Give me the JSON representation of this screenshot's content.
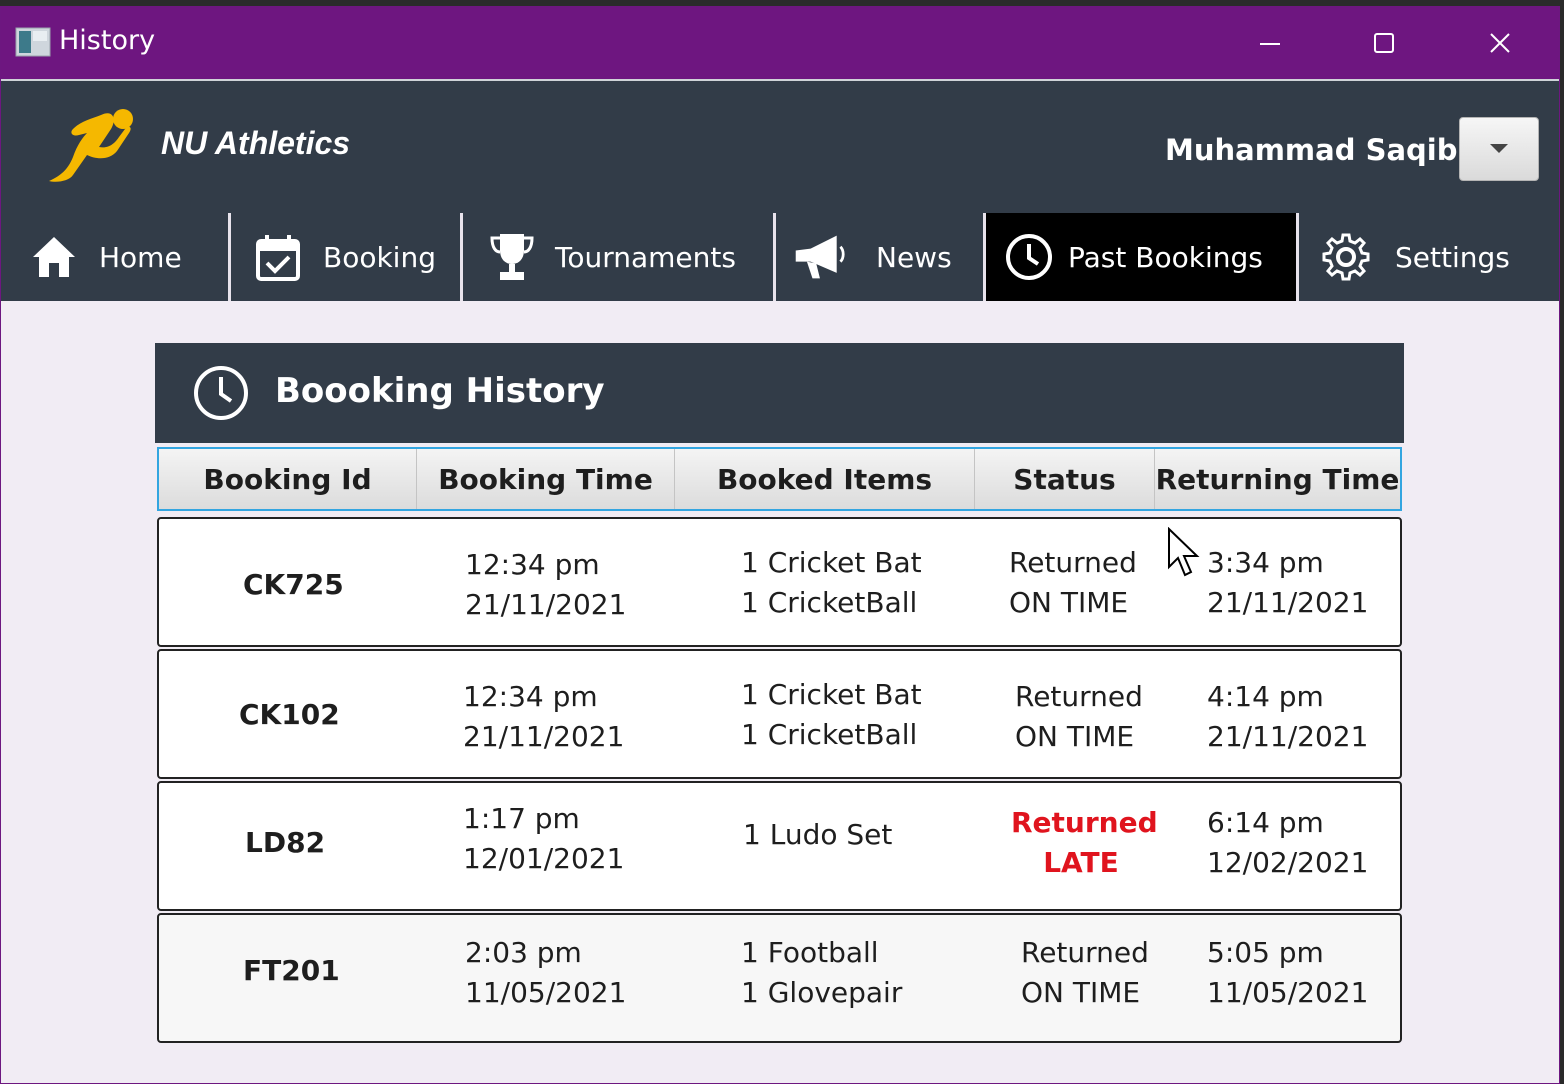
{
  "window": {
    "title": "History"
  },
  "header": {
    "brand": "NU Athletics",
    "username": "Muhammad Saqib"
  },
  "nav": {
    "tabs": [
      {
        "label": "Home",
        "icon": "home-icon"
      },
      {
        "label": "Booking",
        "icon": "calendar-check-icon"
      },
      {
        "label": "Tournaments",
        "icon": "trophy-icon"
      },
      {
        "label": "News",
        "icon": "megaphone-icon"
      },
      {
        "label": "Past Bookings",
        "icon": "clock-icon",
        "active": true
      },
      {
        "label": "Settings",
        "icon": "gear-icon"
      }
    ]
  },
  "history": {
    "title": "Boooking History",
    "columns": [
      "Booking Id",
      "Booking Time",
      "Booked Items",
      "Status",
      "Returning Time"
    ],
    "rows": [
      {
        "id": "CK725",
        "time": "12:34 pm",
        "date": "21/11/2021",
        "item1": "1 Cricket Bat",
        "item2": "1 CricketBall",
        "status1": "Returned",
        "status2": "ON TIME",
        "ret_time": "3:34 pm",
        "ret_date": "21/11/2021"
      },
      {
        "id": "CK102",
        "time": "12:34 pm",
        "date": "21/11/2021",
        "item1": "1 Cricket Bat",
        "item2": "1 CricketBall",
        "status1": "Returned",
        "status2": "ON TIME",
        "ret_time": "4:14 pm",
        "ret_date": "21/11/2021"
      },
      {
        "id": "LD82",
        "time": "1:17 pm",
        "date": "12/01/2021",
        "item1": "1 Ludo Set",
        "item2": "",
        "status1": "Returned",
        "status2": "LATE",
        "ret_time": "6:14 pm",
        "ret_date": "12/02/2021",
        "late": true
      },
      {
        "id": "FT201",
        "time": "2:03 pm",
        "date": "11/05/2021",
        "item1": "1 Football",
        "item2": "1 Glovepair",
        "status1": "Returned",
        "status2": "ON TIME",
        "ret_time": "5:05 pm",
        "ret_date": "11/05/2021"
      }
    ]
  },
  "colors": {
    "titlebar": "#6e1680",
    "header": "#323c48",
    "active_tab": "#000000",
    "late": "#e0141e",
    "accent": "#f5b800"
  }
}
